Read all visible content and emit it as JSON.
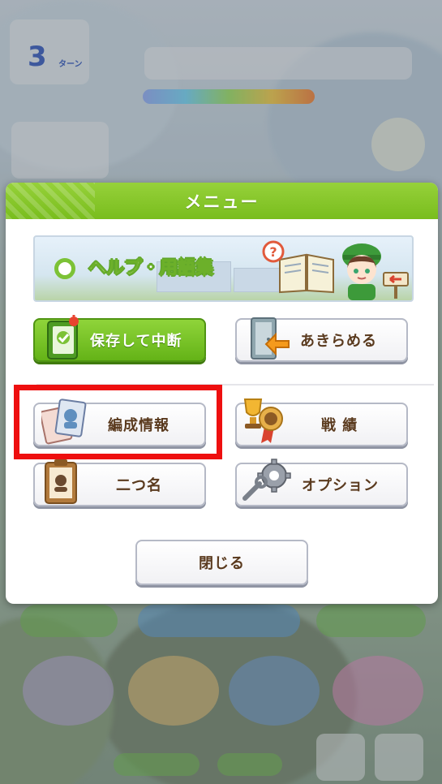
{
  "background": {
    "turn_number": "3",
    "turn_unit": "ターン",
    "plus_label": "+"
  },
  "menu": {
    "title": "メニュー",
    "help_banner": "ヘルプ・用語集",
    "buttons": {
      "save": "保存して中断",
      "give_up": "あきらめる",
      "formation": "編成情報",
      "record": "戦 績",
      "nickname": "二つ名",
      "options": "オプション",
      "close": "閉じる"
    }
  },
  "colors": {
    "header_green": "#79bd1d",
    "label_brown": "#5a3a1e",
    "highlight_red": "#ee0f0f"
  }
}
